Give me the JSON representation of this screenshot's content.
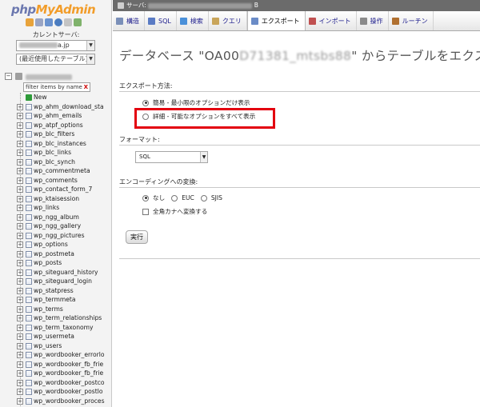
{
  "nav": {
    "logo_php": "php",
    "logo_myadmin": "MyAdmin",
    "current_server_label": "カレントサーバ:",
    "server_select_suffix": "a.jp",
    "recent_tables": "(最近使用したテーブル) ...",
    "filter_placeholder": "filter items by name",
    "filter_clear": "X",
    "tables": [
      "New",
      "wp_ahm_download_sta",
      "wp_ahm_emails",
      "wp_atpf_options",
      "wp_blc_filters",
      "wp_blc_instances",
      "wp_blc_links",
      "wp_blc_synch",
      "wp_commentmeta",
      "wp_comments",
      "wp_contact_form_7",
      "wp_ktaisession",
      "wp_links",
      "wp_ngg_album",
      "wp_ngg_gallery",
      "wp_ngg_pictures",
      "wp_options",
      "wp_postmeta",
      "wp_posts",
      "wp_siteguard_history",
      "wp_siteguard_login",
      "wp_statpress",
      "wp_termmeta",
      "wp_terms",
      "wp_term_relationships",
      "wp_term_taxonomy",
      "wp_usermeta",
      "wp_users",
      "wp_wordbooker_errorlo",
      "wp_wordbooker_fb_frie",
      "wp_wordbooker_fb_frie",
      "wp_wordbooker_postco",
      "wp_wordbooker_postlo",
      "wp_wordbooker_proces"
    ]
  },
  "breadcrumb": {
    "server_prefix": "サーバ:",
    "suffix": "B"
  },
  "tabs": [
    {
      "label": "構造",
      "icon": "structure-icon",
      "color": "#7a8fb8"
    },
    {
      "label": "SQL",
      "icon": "sql-icon",
      "color": "#5a7bc4"
    },
    {
      "label": "検索",
      "icon": "search-icon",
      "color": "#4a90d9"
    },
    {
      "label": "クエリ",
      "icon": "query-icon",
      "color": "#c9a55a"
    },
    {
      "label": "エクスポート",
      "icon": "export-icon",
      "color": "#6b8cc7"
    },
    {
      "label": "インポート",
      "icon": "import-icon",
      "color": "#c05050"
    },
    {
      "label": "操作",
      "icon": "operations-icon",
      "color": "#8a8a8a"
    },
    {
      "label": "ルーチン",
      "icon": "routines-icon",
      "color": "#b07030"
    }
  ],
  "main": {
    "title_prefix": "データベース \"OA00",
    "title_blurred": "D71381_mtsbs88",
    "title_suffix": "\" からテーブルをエクスポ",
    "export_method_heading": "エクスポート方法:",
    "method_quick": "簡易 - 最小限のオプションだけ表示",
    "method_custom": "詳細 - 可能なオプションをすべて表示",
    "format_heading": "フォーマット:",
    "format_value": "SQL",
    "encoding_heading": "エンコーディングへの変換:",
    "encoding_none": "なし",
    "encoding_euc": "EUC",
    "encoding_sjis": "SJIS",
    "kana_option": "全角カナへ変換する",
    "go_button": "実行"
  },
  "colors": {
    "highlight": "#e3000f",
    "logo_php": "#6c78af",
    "logo_myadmin": "#f29d2a"
  }
}
